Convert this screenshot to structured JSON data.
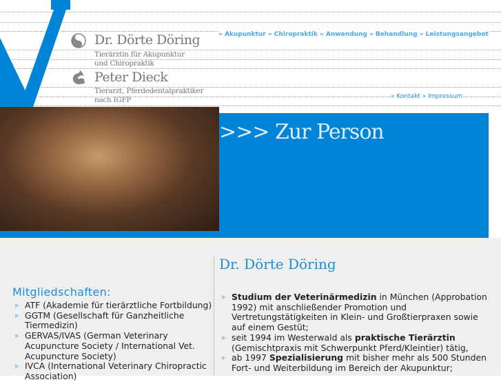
{
  "header": {
    "person1": {
      "name": "Dr. Dörte Döring",
      "subtitle_lines": [
        "Tierärztin für Akupunktur",
        "und Chiropraktik"
      ]
    },
    "person2": {
      "name": "Peter Dieck",
      "subtitle_lines": [
        "Tierarzt, Pferdedentalpraktiker",
        "nach IGFP"
      ]
    }
  },
  "nav_main": [
    "» Akupunktur",
    "» Chiropraktik",
    "» Anwendung",
    "» Behandlung",
    "» Leistungsangebot"
  ],
  "nav_secondary": [
    "» Kontakt",
    "» Impressum"
  ],
  "banner": {
    "title": ">>> Zur Person"
  },
  "sidebar": {
    "heading": "Mitgliedschaften:",
    "items": [
      "ATF (Akademie für tierärztliche Fortbildung)",
      "GGTM (Gesellschaft für Ganzheitliche Tiermedizin)",
      "GERVAS/IVAS (German Veterinary Acupuncture Society / International Vet. Acupuncture Society)",
      "IVCA (International Veterinary Chiropractic Association)"
    ]
  },
  "main": {
    "heading": "Dr. Dörte Döring",
    "items": [
      {
        "bold": "Studium der Veterinärmedizin",
        "rest": " in München (Approbation 1992) mit anschließender Promotion und Vertretungstätigkeiten in Klein- und Großtierpraxen sowie auf einem Gestüt;"
      },
      {
        "pre": "seit 1994 im Westerwald als ",
        "bold": "praktische Tierärztin",
        "rest": " (Gemischtpraxis mit Schwerpunkt Pferd/Kleintier) tätig,"
      },
      {
        "pre": "ab 1997 ",
        "bold": "Spezialisierung",
        "rest": " mit bisher mehr als 500 Stunden Fort- und Weiterbildung im Bereich der Akupunktur;"
      }
    ]
  },
  "colors": {
    "brand": "#0084d8",
    "link": "#4aa8e6"
  }
}
